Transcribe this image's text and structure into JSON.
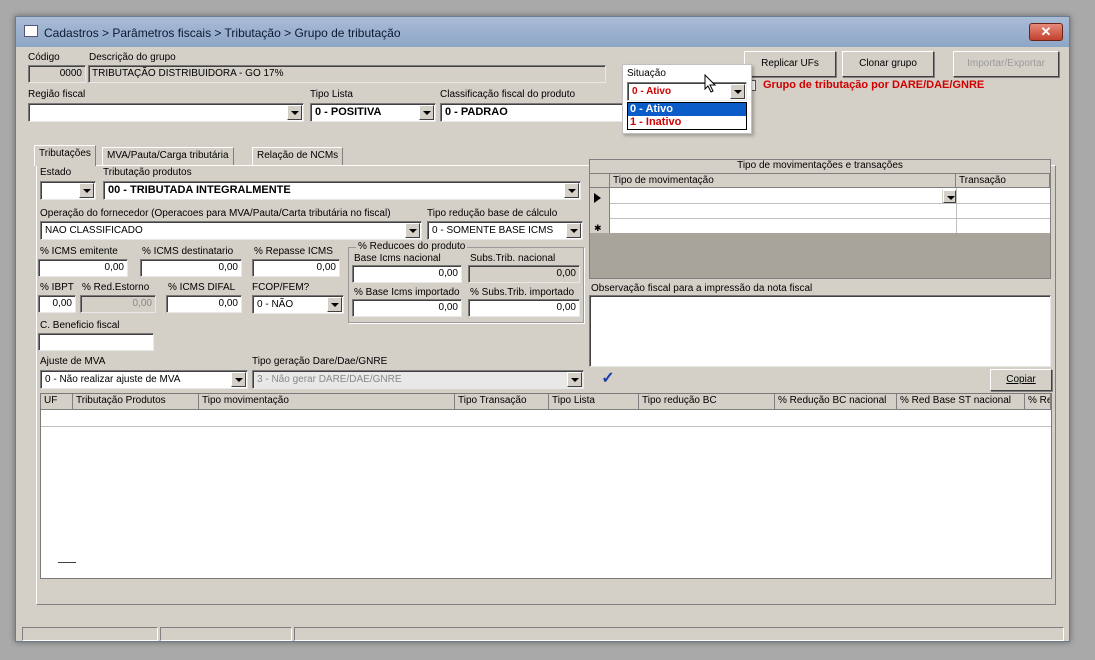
{
  "window": {
    "title": "Cadastros > Parâmetros fiscais > Tributação > Grupo de tributação",
    "close_label": "✕"
  },
  "header": {
    "codigo_label": "Código",
    "codigo_value": "0000",
    "descricao_label": "Descrição do grupo",
    "descricao_value": "TRIBUTAÇÃO DISTRIBUIDORA - GO 17%",
    "regiao_label": "Região fiscal",
    "regiao_value": "",
    "tipo_lista_label": "Tipo Lista",
    "tipo_lista_value": "0 - POSITIVA",
    "classificacao_label": "Classificação fiscal do produto",
    "classificacao_value": "0 - PADRAO",
    "situacao_label": "Situação",
    "situacao_value": "0 - Ativo",
    "situacao_options": [
      "0 - Ativo",
      "1 - Inativo"
    ],
    "replicar_label": "Replicar UFs",
    "clonar_label": "Clonar grupo",
    "importar_label": "Importar/Exportar",
    "dare_label": "Grupo de tributação por DARE/DAE/GNRE"
  },
  "tabs": [
    "Tributações",
    "MVA/Pauta/Carga tributária",
    "Relação de NCMs"
  ],
  "trib": {
    "estado_label": "Estado",
    "estado_value": "",
    "trib_prod_label": "Tributação produtos",
    "trib_prod_value": "00 - TRIBUTADA INTEGRALMENTE",
    "operacao_label": "Operação do fornecedor (Operacoes para MVA/Pauta/Carta tributária no fiscal)",
    "operacao_value": "NAO CLASSIFICADO",
    "tipo_reducao_label": "Tipo redução base de cálculo",
    "tipo_reducao_value": "0 - SOMENTE BASE ICMS",
    "icms_emit_label": "% ICMS emitente",
    "icms_emit_value": "0,00",
    "icms_dest_label": "% ICMS destinatario",
    "icms_dest_value": "0,00",
    "repasse_label": "% Repasse ICMS",
    "repasse_value": "0,00",
    "reducoes_label": "% Reducoes do produto",
    "base_nac_label": "Base Icms nacional",
    "base_nac_value": "0,00",
    "subs_nac_label": "Subs.Trib. nacional",
    "subs_nac_value": "0,00",
    "base_imp_label": "% Base Icms importado",
    "base_imp_value": "0,00",
    "subs_imp_label": "% Subs.Trib. importado",
    "subs_imp_value": "0,00",
    "ibpt_label": "% IBPT",
    "ibpt_value": "0,00",
    "red_estorno_label": "% Red.Estorno",
    "red_estorno_value": "0,00",
    "difal_label": "% ICMS DIFAL",
    "difal_value": "0,00",
    "fcop_label": "FCOP/FEM?",
    "fcop_value": "0 - NÃO",
    "beneficio_label": "C. Beneficio fiscal",
    "beneficio_value": "",
    "ajuste_label": "Ajuste de MVA",
    "ajuste_value": "0 - Não realizar ajuste de MVA",
    "tipo_geracao_label": "Tipo geração Dare/Dae/GNRE",
    "tipo_geracao_value": "3 - Não gerar DARE/DAE/GNRE",
    "copiar_label": "Copiar"
  },
  "movimentacoes": {
    "title": "Tipo de movimentações e transações",
    "col_tipo": "Tipo de movimentação",
    "col_transacao": "Transação",
    "obs_label": "Observação fiscal para a impressão da nota fiscal"
  },
  "grid": {
    "columns": [
      "UF",
      "Tributação Produtos",
      "Tipo movimentação",
      "Tipo Transação",
      "Tipo Lista",
      "Tipo redução BC",
      "% Redução BC nacional",
      "% Red Base ST nacional",
      "% Re"
    ]
  }
}
